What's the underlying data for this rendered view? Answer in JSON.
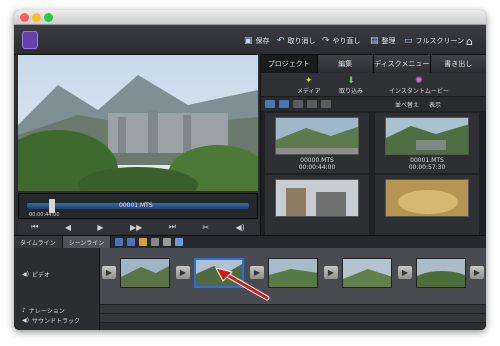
{
  "toolbar": {
    "save": "保存",
    "undo": "取り消し",
    "redo": "やり直し",
    "organize": "整理",
    "fullscreen": "フルスクリーン"
  },
  "panel": {
    "tabs": [
      "プロジェクト",
      "編集",
      "ディスクメニュー",
      "書き出し"
    ],
    "subtabs": [
      "メディア",
      "取り込み",
      "インスタントムービー"
    ],
    "sort_label": "並べ替え",
    "display_label": "表示",
    "clips": [
      {
        "name": "00000.MTS",
        "duration": "00:00:44:00"
      },
      {
        "name": "00001.MTS",
        "duration": "00:00:57:30"
      }
    ]
  },
  "preview": {
    "clip_label": "00001.MTS",
    "timecode": "00:00:44:00"
  },
  "timeline": {
    "tabs": [
      "タイムライン",
      "シーンライン"
    ],
    "tracks": [
      "ビデオ",
      "ナレーション",
      "サウンドトラック"
    ]
  }
}
